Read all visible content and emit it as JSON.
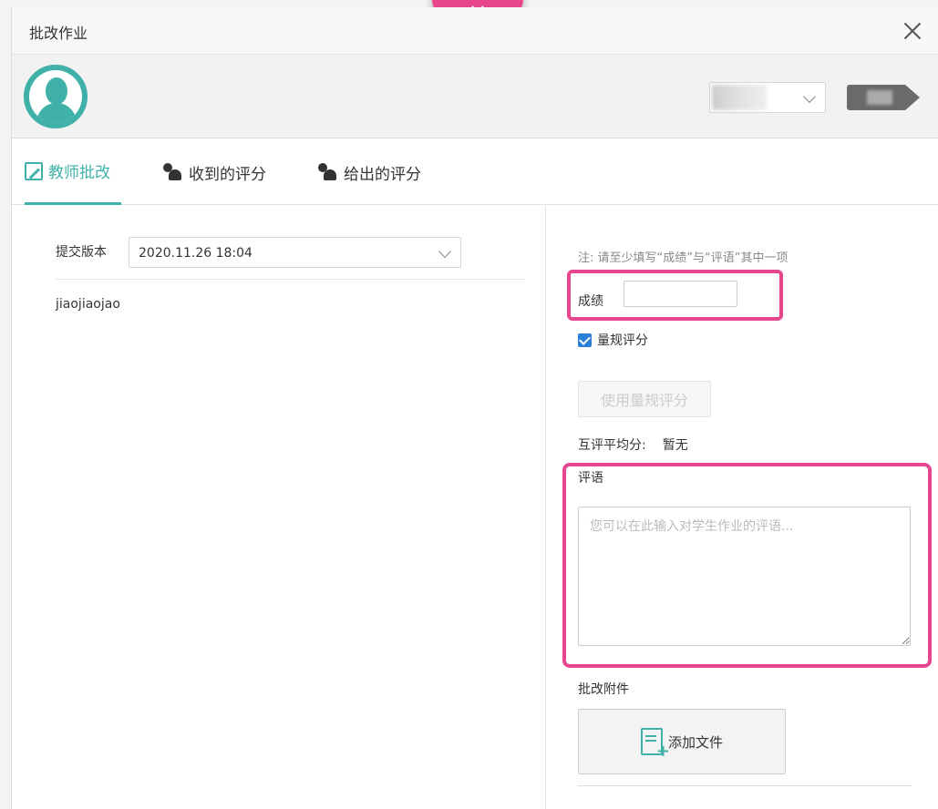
{
  "dialog": {
    "title": "批改作业"
  },
  "tabs": [
    {
      "label": "教师批改",
      "active": true,
      "icon": "edit-icon"
    },
    {
      "label": "收到的评分",
      "active": false,
      "icon": "people-check-icon"
    },
    {
      "label": "给出的评分",
      "active": false,
      "icon": "people-pen-icon"
    }
  ],
  "submission": {
    "version_label": "提交版本",
    "version_value": "2020.11.26 18:04",
    "content": "jiaojiaojao"
  },
  "grading": {
    "note": "注: 请至少填写“成绩”与“评语”其中一项",
    "score_label": "成绩",
    "score_value": "",
    "rubric_label": "量规评分",
    "rubric_checked": true,
    "use_rubric_button": "使用量规评分",
    "peer_avg_label": "互评平均分:",
    "peer_avg_value": "暂无",
    "comment_label": "评语",
    "comment_placeholder": "您可以在此输入对学生作业的评语...",
    "attachment_label": "批改附件",
    "add_file_button": "添加文件"
  },
  "colors": {
    "accent": "#3fb1a9",
    "highlight": "#e5478e",
    "checkbox": "#2a7fd6"
  }
}
